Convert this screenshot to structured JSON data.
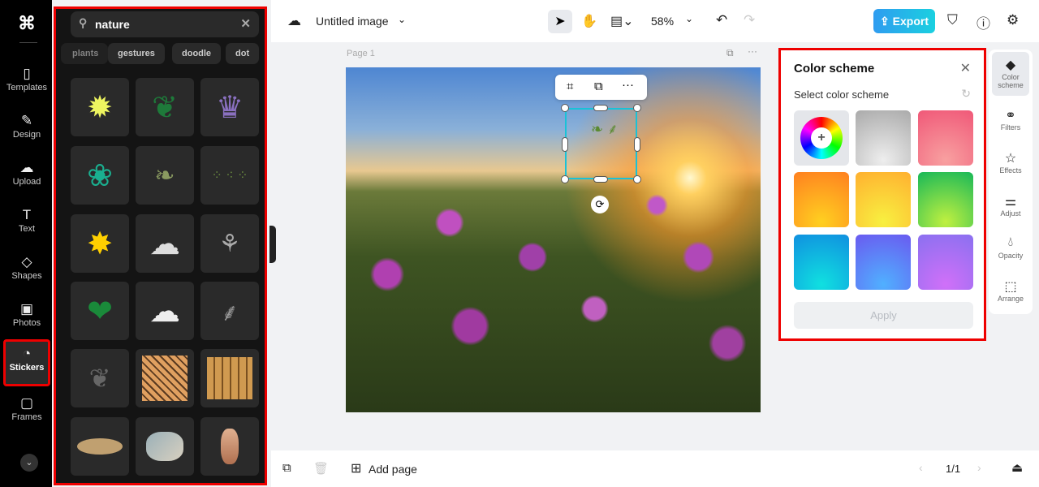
{
  "nav": {
    "items": [
      {
        "label": "Templates",
        "icon": "templates-icon"
      },
      {
        "label": "Design",
        "icon": "design-icon"
      },
      {
        "label": "Upload",
        "icon": "upload-icon"
      },
      {
        "label": "Text",
        "icon": "text-icon"
      },
      {
        "label": "Shapes",
        "icon": "shapes-icon"
      },
      {
        "label": "Photos",
        "icon": "photos-icon"
      },
      {
        "label": "Stickers",
        "icon": "stickers-icon"
      },
      {
        "label": "Frames",
        "icon": "frames-icon"
      }
    ],
    "active": "Stickers"
  },
  "panel": {
    "search_value": "nature",
    "chips": [
      "plants",
      "gestures",
      "doodle",
      "dot"
    ]
  },
  "header": {
    "title": "Untitled image",
    "zoom": "58%",
    "export_label": "Export",
    "accent": "#1fb8e6"
  },
  "canvas": {
    "page_label": "Page 1"
  },
  "color_scheme": {
    "title": "Color scheme",
    "subtitle": "Select color scheme",
    "apply_label": "Apply",
    "swatches": [
      "#c0c0c0",
      "#f3708a",
      "#ffa020",
      "#ffe040",
      "#22c050",
      "#10c0e8",
      "#5a7af8",
      "#b070f0"
    ]
  },
  "rail": {
    "items": [
      "Color scheme",
      "Filters",
      "Effects",
      "Adjust",
      "Opacity",
      "Arrange"
    ]
  },
  "footer": {
    "add_page": "Add page",
    "pagination": "1/1"
  }
}
